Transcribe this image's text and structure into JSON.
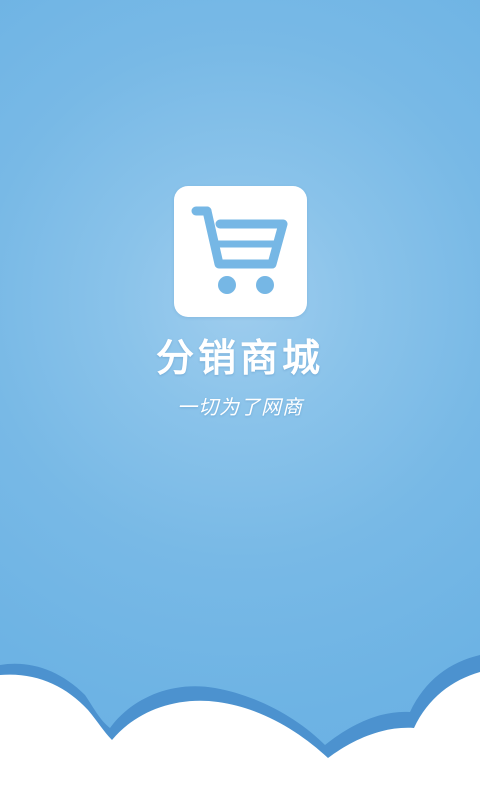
{
  "app": {
    "name": "分销商城",
    "slogan": "一切为了网商"
  },
  "logo": {
    "icon": "shopping-cart-icon"
  },
  "colors": {
    "background_center": "#9fcdee",
    "background_edge": "#6aafe2",
    "logo_tile": "#ffffff",
    "cart": "#76b7e5",
    "cloud": "#ffffff",
    "cloud_shadow": "#4c92cf",
    "text": "#ffffff"
  }
}
